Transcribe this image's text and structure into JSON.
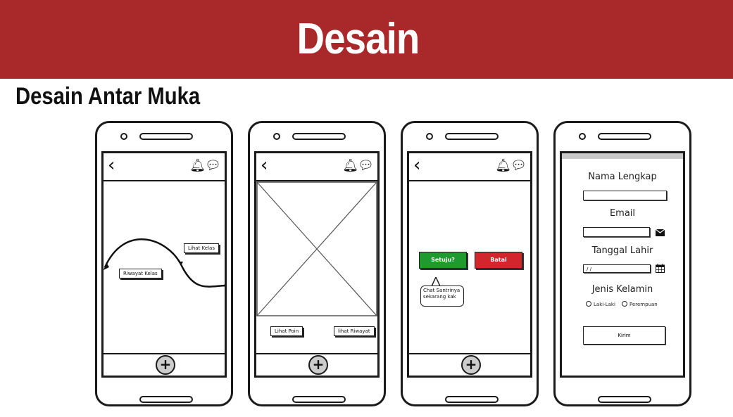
{
  "header": {
    "title": "Desain"
  },
  "subtitle": "Desain Antar Muka",
  "phone1": {
    "back_icon": "chevron-left",
    "bell_icon": "bell",
    "chat_icon": "chat-bubble",
    "lihat_kelas": "Lihat Kelas",
    "riwayat_kelas": "Riwayat Kelas",
    "fab": "+"
  },
  "phone2": {
    "lihat_poin": "Lihat Poin",
    "lihat_riwayat": "lihat Riwayat",
    "fab": "+"
  },
  "phone3": {
    "setuju": "Setuju?",
    "batal": "Batal",
    "chat_text": "Chat Santrinya sekarang kak",
    "fab": "+"
  },
  "phone4": {
    "nama_label": "Nama Lengkap",
    "email_label": "Email",
    "tanggal_label": "Tanggal Lahir",
    "date_value": "/ /",
    "jenis_label": "Jenis Kelamin",
    "option_male": "Laki-Laki",
    "option_female": "Perempuan",
    "kirim": "Kirim",
    "mail_icon": "envelope",
    "calendar_icon": "calendar"
  },
  "colors": {
    "banner": "#a9282a",
    "setuju": "#1e9a2e",
    "batal": "#d2262c"
  }
}
